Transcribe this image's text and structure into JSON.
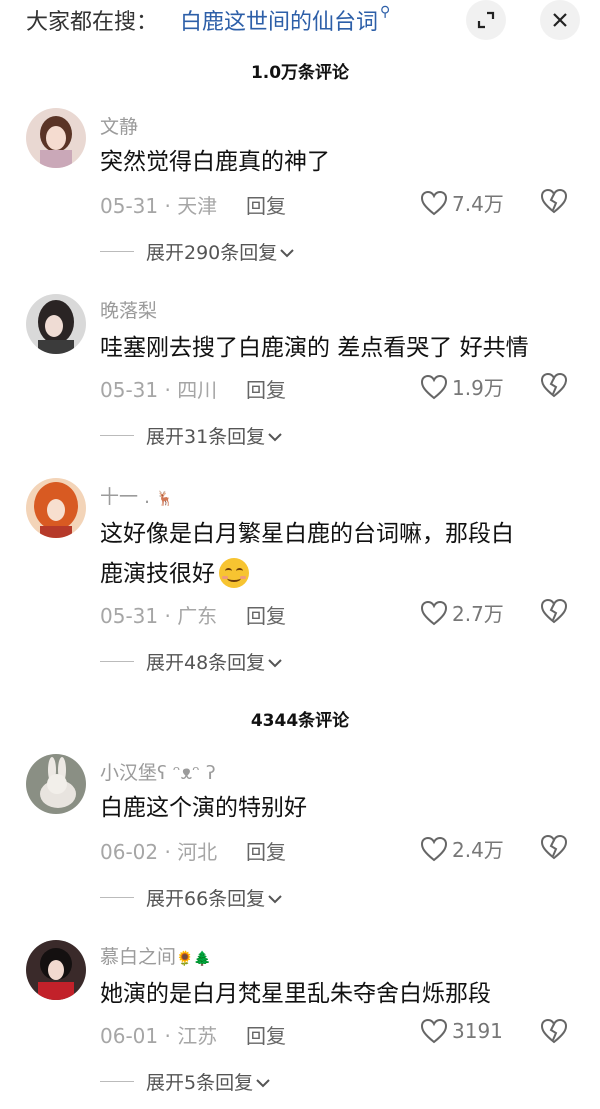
{
  "search": {
    "prefix": "大家都在搜：",
    "query": "白鹿这世间的仙台词",
    "query_icon": "search-icon"
  },
  "top_actions": [
    {
      "icon": "exit-fullscreen-icon"
    },
    {
      "icon": "close-icon"
    }
  ],
  "sections": [
    {
      "title": "1.0万条评论"
    },
    {
      "title": "4344条评论"
    }
  ],
  "comments": [
    {
      "username": "文静",
      "username_deco": "",
      "text": "突然觉得白鹿真的神了",
      "text2": "",
      "date_location": "05-31 · 天津",
      "reply": "回复",
      "likes": "7.4万",
      "expand": "展开290条回复"
    },
    {
      "username": "晚落梨",
      "username_deco": "",
      "text": "哇塞刚去搜了白鹿演的 差点看哭了 好共情",
      "text2": "",
      "date_location": "05-31 · 四川",
      "reply": "回复",
      "likes": "1.9万",
      "expand": "展开31条回复"
    },
    {
      "username": "十一 .",
      "username_deco": "🦌",
      "text": "这好像是白月繁星白鹿的台词嘛，那段白",
      "text2": "鹿演技很好",
      "date_location": "05-31 · 广东",
      "reply": "回复",
      "likes": "2.7万",
      "expand": "展开48条回复"
    },
    {
      "username": "小汉堡ʕ ᵔᴥᵔ ʔ",
      "username_deco": "",
      "text": "白鹿这个演的特别好",
      "text2": "",
      "date_location": "06-02 · 河北",
      "reply": "回复",
      "likes": "2.4万",
      "expand": "展开66条回复"
    },
    {
      "username": "慕白之间",
      "username_deco": "🌻🌲",
      "text": "她演的是白月梵星里乱朱夺舍白烁那段",
      "text2": "",
      "date_location": "06-01 · 江苏",
      "reply": "回复",
      "likes": "3191",
      "expand": "展开5条回复"
    }
  ],
  "colors": {
    "link": "#2d5fa8",
    "muted": "#a6a6a6"
  }
}
